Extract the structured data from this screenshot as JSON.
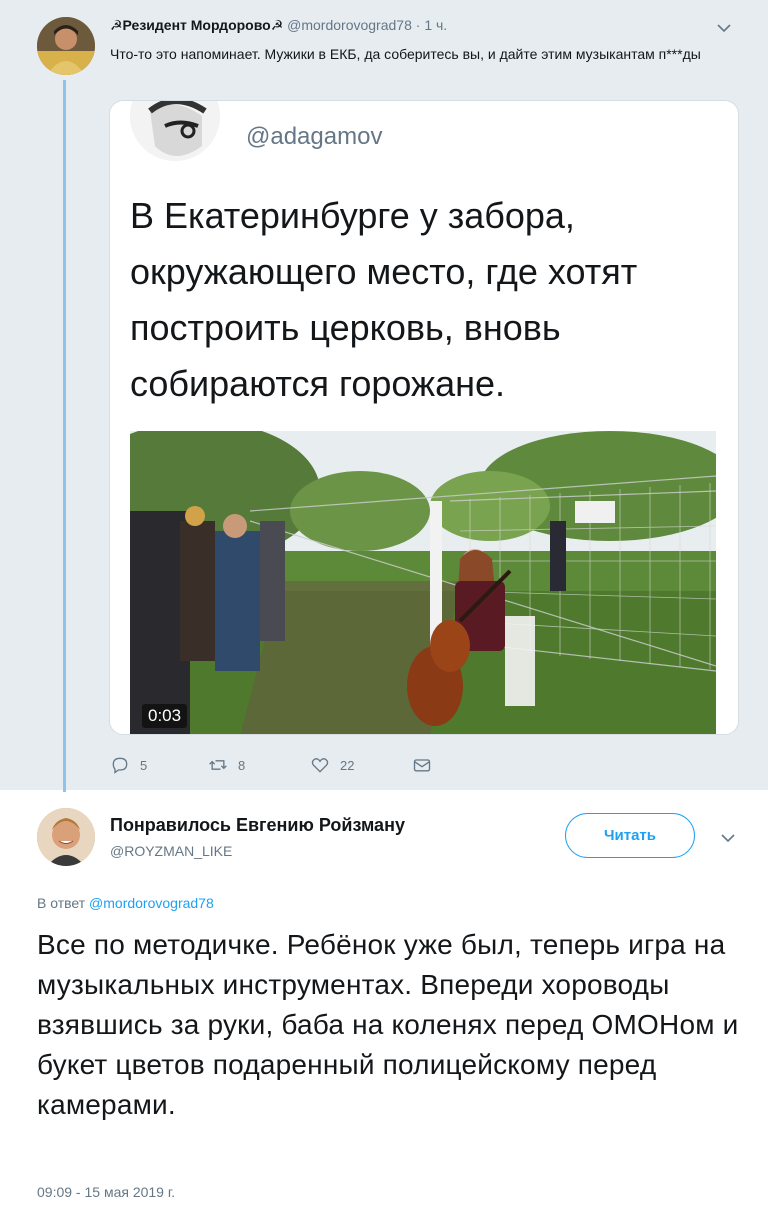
{
  "parent_tweet": {
    "display_name": "☭Резидент Мордорово☭",
    "handle": "@mordorovograd78",
    "separator": "·",
    "time": "1 ч.",
    "text": "Что-то это напоминает. Мужики в ЕКБ, да соберитесь вы, и дайте этим музыкантам п***ды",
    "quoted_image": {
      "handle": "@adagamov",
      "text": "В Екатеринбурге у забора, окружающего место, где хотят построить церковь, вновь собираются горожане.",
      "video_duration": "0:03"
    },
    "actions": {
      "reply_count": "5",
      "retweet_count": "8",
      "like_count": "22"
    }
  },
  "main_tweet": {
    "display_name": "Понравилось Евгению Ройзману",
    "handle": "@ROYZMAN_LIKE",
    "follow_label": "Читать",
    "reply_prefix": "В ответ",
    "reply_to_handle": "@mordorovograd78",
    "text": "Все по методичке. Ребёнок уже был, теперь игра на музыкальных инструментах. Впереди хороводы взявшись за руки, баба на коленях перед ОМОНом и букет цветов подаренный полицейскому перед камерами.",
    "timestamp": "09:09 - 15 мая 2019 г."
  },
  "icons": {
    "reply": "reply-icon",
    "retweet": "retweet-icon",
    "like": "heart-icon",
    "dm": "envelope-icon",
    "more": "chevron-down-icon"
  },
  "colors": {
    "accent": "#1da1f2",
    "thread_line": "#8ec4e8",
    "context_bg": "#e6ecf0",
    "secondary_text": "#657786"
  }
}
